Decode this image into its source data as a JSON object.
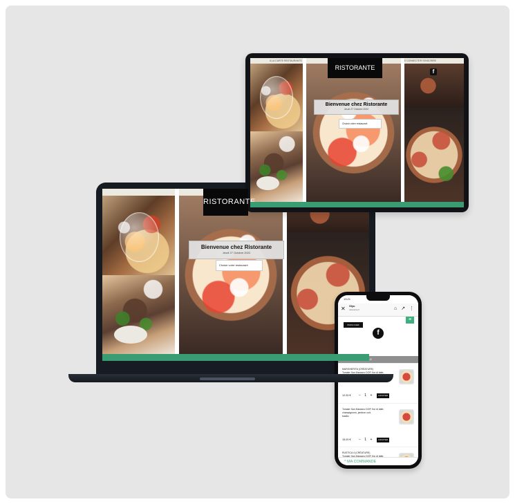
{
  "laptop": {
    "topbar_text": "A LA CARTE   RESTAURANTS",
    "brand": "RISTORANTE",
    "hero_title": "Bienvenue chez Ristorante",
    "hero_date": "Jeudi 27 Octobre 2022",
    "select_placeholder": "Choisir votre restaurant"
  },
  "tablet": {
    "topbar_left": "A LA CARTE   RESTAURANTS",
    "topbar_right": "SE CONNECTER   S'INSCRIRE",
    "brand": "RISTORANTE",
    "fb_icon": "f",
    "hero_title": "Bienvenue chez Ristorante",
    "hero_date": "Jeudi 27 Octobre 2022",
    "select_placeholder": "Choisir votre restaurant"
  },
  "phone": {
    "time": "13:21",
    "browser_title": "Oiyu",
    "browser_subtitle": "ristorante.fr",
    "menu_badge": "PIZZA CHEF",
    "hamburger_icon": "≡",
    "fb_icon": "f",
    "section_title": "PIZZA TRADITIONNELLE",
    "items": [
      {
        "title": "MARGHERITA (CRÉATURE)",
        "line1": "Tomate San Marzano DOP, fior di latte,",
        "line2": "basilic, huile d'olive extra vierge",
        "line3": "Mozzarella di Bufala DOP +3€",
        "price": "12.00 €",
        "controls": "− 1 +",
        "add_label": "AJOUTER"
      },
      {
        "title": "",
        "line1": "Tomate San Marzano DOP, fior di latte,",
        "line2": "champignons, jambon cuit,",
        "line3": "basilic",
        "price": "15.00 €",
        "controls": "− 1 +",
        "add_label": "AJOUTER"
      },
      {
        "title": "RUSTICA 4 (CRÉATURE)",
        "line1": "Tomate San Marzano DOP, fior di latte,",
        "line2": "",
        "line3": "",
        "price": "",
        "controls": "",
        "add_label": ""
      }
    ],
    "bottom_action": "^ MA COMMANDE"
  }
}
